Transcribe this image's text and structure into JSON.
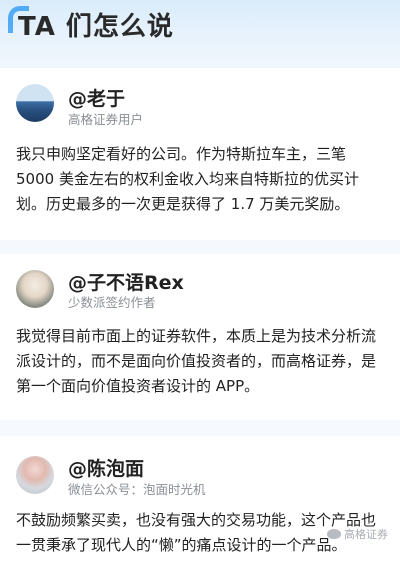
{
  "header": {
    "title": "TA 们怎么说"
  },
  "testimonials": [
    {
      "name": "@老于",
      "subtitle": "高格证券用户",
      "text": "我只申购坚定看好的公司。作为特斯拉车主，三笔 5000 美金左右的权利金收入均来自特斯拉的优买计划。历史最多的一次更是获得了 1.7 万美元奖励。"
    },
    {
      "name": "@子不语Rex",
      "subtitle": "少数派签约作者",
      "text": "我觉得目前市面上的证券软件，本质上是为技术分析流派设计的，而不是面向价值投资者的，而高格证券，是第一个面向价值投资者设计的 APP。"
    },
    {
      "name": "@陈泡面",
      "subtitle": "微信公众号：泡面时光机",
      "text": "不鼓励频繁买卖，也没有强大的交易功能，这个产品也一贯秉承了现代人的“懒”的痛点设计的一个产品。"
    }
  ],
  "watermark": {
    "text": "高格证券"
  }
}
